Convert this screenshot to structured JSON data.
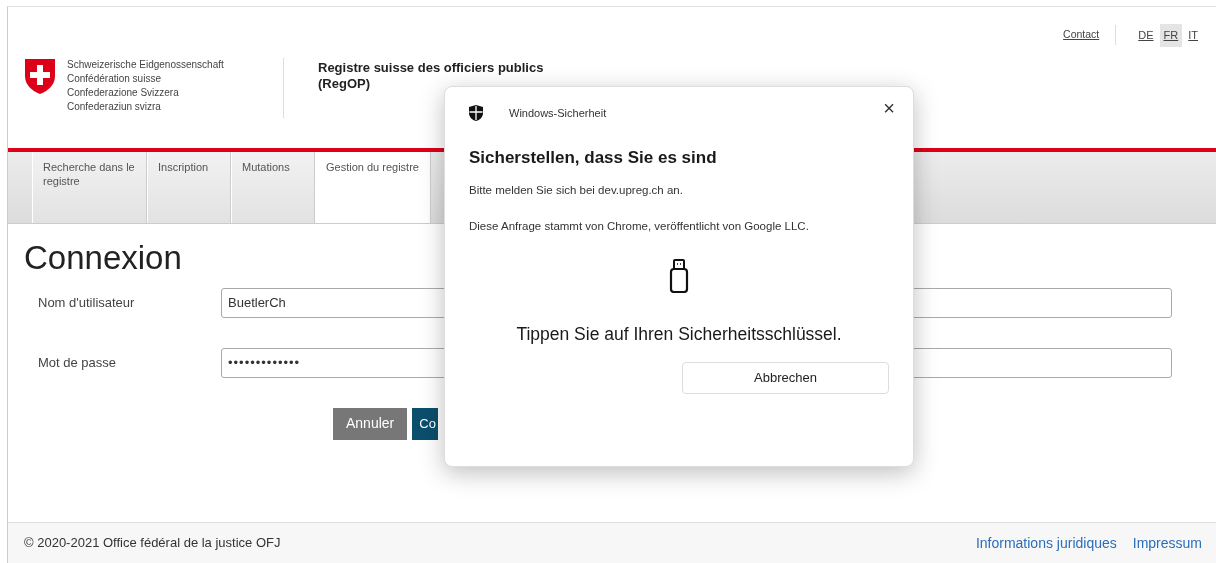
{
  "header": {
    "agency_lines": [
      "Schweizerische Eidgenossenschaft",
      "Confédération suisse",
      "Confederazione Svizzera",
      "Confederaziun svizra"
    ],
    "site_title": "Registre suisse des officiers publics (RegOP)",
    "contact": "Contact",
    "languages": [
      {
        "label": "DE",
        "selected": false
      },
      {
        "label": "FR",
        "selected": true
      },
      {
        "label": "IT",
        "selected": false
      }
    ]
  },
  "tabs": [
    {
      "label": "Recherche dans le registre",
      "selected": false
    },
    {
      "label": "Inscription",
      "selected": false
    },
    {
      "label": "Mutations",
      "selected": false
    },
    {
      "label": "Gestion du registre",
      "selected": true
    }
  ],
  "login": {
    "title": "Connexion",
    "fields": [
      {
        "label": "Nom d'utilisateur",
        "value": "BuetlerCh",
        "kind": "text"
      },
      {
        "label": "Mot de passe",
        "value": "•••••••••••••",
        "kind": "password"
      }
    ],
    "buttons": [
      {
        "label": "Annuler",
        "kind": "secondary"
      },
      {
        "label": "Co",
        "kind": "primary"
      }
    ]
  },
  "footer": {
    "copyright": "© 2020-2021 Office fédéral de la justice OFJ",
    "links": [
      "Informations juridiques",
      "Impressum"
    ]
  },
  "dialog": {
    "app": "Windows-Sicherheit",
    "close": "×",
    "title": "Sicherstellen, dass Sie es sind",
    "lines": [
      "Bitte melden Sie sich bei dev.upreg.ch an.",
      "Diese Anfrage stammt von Chrome, veröffentlicht von Google LLC."
    ],
    "prompt": "Tippen Sie auf Ihren Sicherheitsschlüssel.",
    "button": "Abbrechen"
  }
}
